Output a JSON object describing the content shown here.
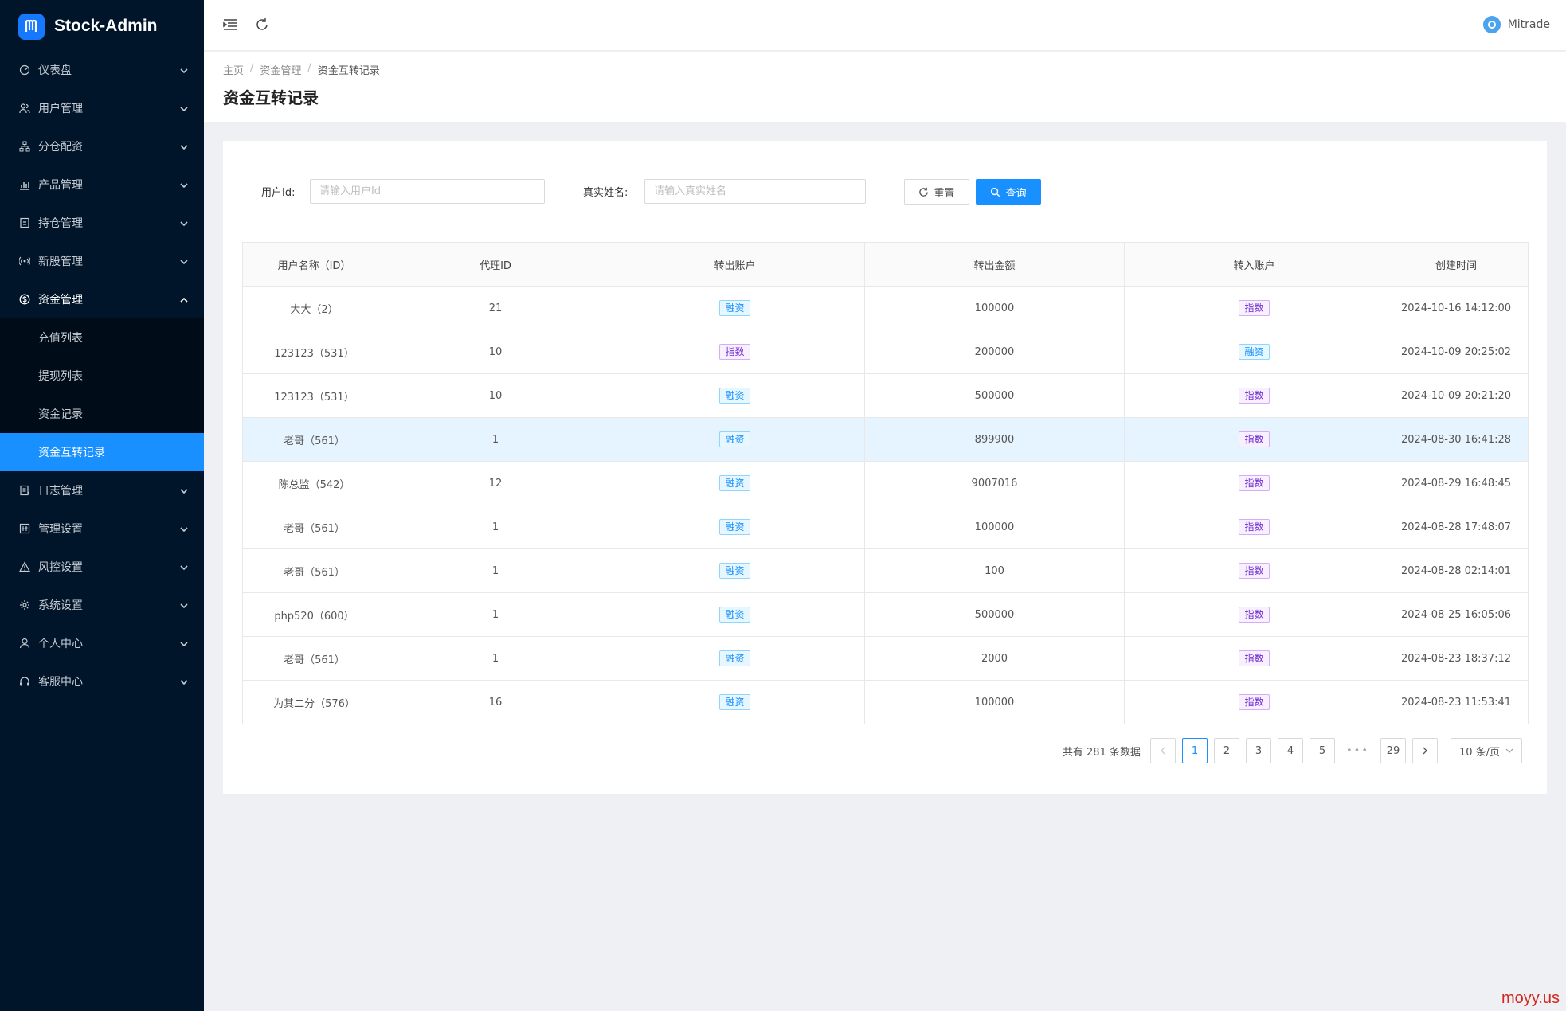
{
  "app": {
    "name": "Stock-Admin"
  },
  "sidebar": {
    "items": [
      {
        "label": "仪表盘",
        "icon": "dashboard-icon"
      },
      {
        "label": "用户管理",
        "icon": "users-icon"
      },
      {
        "label": "分仓配资",
        "icon": "sitemap-icon"
      },
      {
        "label": "产品管理",
        "icon": "bar-chart-icon"
      },
      {
        "label": "持仓管理",
        "icon": "holding-icon"
      },
      {
        "label": "新股管理",
        "icon": "broadcast-icon"
      },
      {
        "label": "资金管理",
        "icon": "dollar-icon"
      },
      {
        "label": "日志管理",
        "icon": "log-icon"
      },
      {
        "label": "管理设置",
        "icon": "settings-panel-icon"
      },
      {
        "label": "风控设置",
        "icon": "warning-icon"
      },
      {
        "label": "系统设置",
        "icon": "gear-icon"
      },
      {
        "label": "个人中心",
        "icon": "person-icon"
      },
      {
        "label": "客服中心",
        "icon": "headset-icon"
      }
    ],
    "submenu": [
      "充值列表",
      "提现列表",
      "资金记录",
      "资金互转记录"
    ]
  },
  "header": {
    "user_name": "Mitrade"
  },
  "breadcrumb": [
    "主页",
    "资金管理",
    "资金互转记录"
  ],
  "page_title": "资金互转记录",
  "filters": {
    "user_id_label": "用户Id:",
    "user_id_placeholder": "请输入用户Id",
    "real_name_label": "真实姓名:",
    "real_name_placeholder": "请输入真实姓名",
    "reset_label": "重置",
    "query_label": "查询"
  },
  "table": {
    "columns": [
      "用户名称（ID）",
      "代理ID",
      "转出账户",
      "转出金额",
      "转入账户",
      "创建时间"
    ],
    "rows": [
      [
        "大大（2）",
        "21",
        "融资",
        "100000",
        "指数",
        "2024-10-16 14:12:00"
      ],
      [
        "123123（531）",
        "10",
        "指数",
        "200000",
        "融资",
        "2024-10-09 20:25:02"
      ],
      [
        "123123（531）",
        "10",
        "融资",
        "500000",
        "指数",
        "2024-10-09 20:21:20"
      ],
      [
        "老哥（561）",
        "1",
        "融资",
        "899900",
        "指数",
        "2024-08-30 16:41:28"
      ],
      [
        "陈总监（542）",
        "12",
        "融资",
        "9007016",
        "指数",
        "2024-08-29 16:48:45"
      ],
      [
        "老哥（561）",
        "1",
        "融资",
        "100000",
        "指数",
        "2024-08-28 17:48:07"
      ],
      [
        "老哥（561）",
        "1",
        "融资",
        "100",
        "指数",
        "2024-08-28 02:14:01"
      ],
      [
        "php520（600）",
        "1",
        "融资",
        "500000",
        "指数",
        "2024-08-25 16:05:06"
      ],
      [
        "老哥（561）",
        "1",
        "融资",
        "2000",
        "指数",
        "2024-08-23 18:37:12"
      ],
      [
        "为其二分（576）",
        "16",
        "融资",
        "100000",
        "指数",
        "2024-08-23 11:53:41"
      ]
    ],
    "highlighted_row": 3
  },
  "pagination": {
    "total_text": "共有 281 条数据",
    "pages": [
      "1",
      "2",
      "3",
      "4",
      "5",
      "•••",
      "29"
    ],
    "current": "1",
    "page_size": "10 条/页"
  },
  "watermark": "moyy.us",
  "colors": {
    "sidebar_bg": "#001529",
    "accent": "#1890ff"
  }
}
